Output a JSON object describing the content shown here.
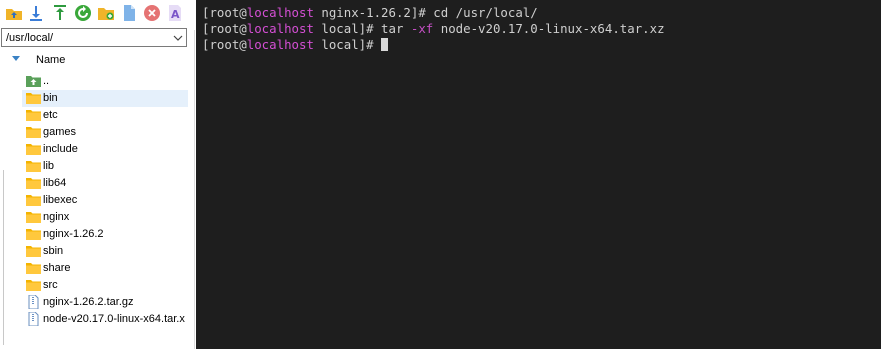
{
  "file_browser": {
    "toolbar": [
      {
        "icon": "upload-folder-icon",
        "color": "#e8a317"
      },
      {
        "icon": "download-icon",
        "color": "#3b7dd8"
      },
      {
        "icon": "upload-icon",
        "color": "#2e9a3e"
      },
      {
        "icon": "refresh-icon",
        "color": "#3aa83a"
      },
      {
        "icon": "new-folder-icon",
        "color": "#e8b317"
      },
      {
        "icon": "new-file-icon",
        "color": "#5b9bd5"
      },
      {
        "icon": "delete-icon",
        "color": "#e05555"
      },
      {
        "icon": "rename-icon",
        "color": "#7a55c8"
      }
    ],
    "path": "/usr/local/",
    "column_name": "Name",
    "items": [
      {
        "name": "..",
        "type": "parent"
      },
      {
        "name": "bin",
        "type": "folder",
        "selected": true
      },
      {
        "name": "etc",
        "type": "folder"
      },
      {
        "name": "games",
        "type": "folder"
      },
      {
        "name": "include",
        "type": "folder"
      },
      {
        "name": "lib",
        "type": "folder"
      },
      {
        "name": "lib64",
        "type": "folder"
      },
      {
        "name": "libexec",
        "type": "folder"
      },
      {
        "name": "nginx",
        "type": "folder"
      },
      {
        "name": "nginx-1.26.2",
        "type": "folder"
      },
      {
        "name": "sbin",
        "type": "folder"
      },
      {
        "name": "share",
        "type": "folder"
      },
      {
        "name": "src",
        "type": "folder"
      },
      {
        "name": "nginx-1.26.2.tar.gz",
        "type": "file"
      },
      {
        "name": "node-v20.17.0-linux-x64.tar.x",
        "type": "file"
      }
    ]
  },
  "terminal": {
    "lines": [
      {
        "pre": "[root@",
        "host": "localhost",
        "mid": " nginx-1.26.2]# ",
        "cmd": "cd /usr/local/",
        "opt": "",
        "post": ""
      },
      {
        "pre": "[root@",
        "host": "localhost",
        "mid": " local]# ",
        "cmd": "tar ",
        "opt": "-xf",
        "post": " node-v20.17.0-linux-x64.tar.xz"
      },
      {
        "pre": "[root@",
        "host": "localhost",
        "mid": " local]# ",
        "cmd": "",
        "opt": "",
        "post": ""
      }
    ],
    "colors": {
      "background": "#1e1e1e",
      "text": "#cfcfcf",
      "host": "#d44fd4"
    }
  }
}
